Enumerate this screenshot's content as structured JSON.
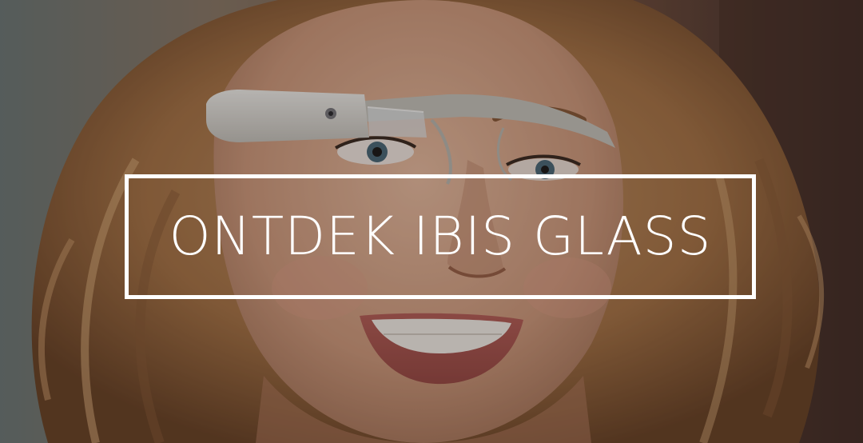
{
  "hero": {
    "cta_label": "ONTDEK IBIS GLASS"
  },
  "colors": {
    "cta_border": "#ffffff",
    "cta_text": "#ffffff",
    "hair": "#b88a5c",
    "skin": "#d9a88a",
    "glass_frame": "#e8e6e2"
  }
}
